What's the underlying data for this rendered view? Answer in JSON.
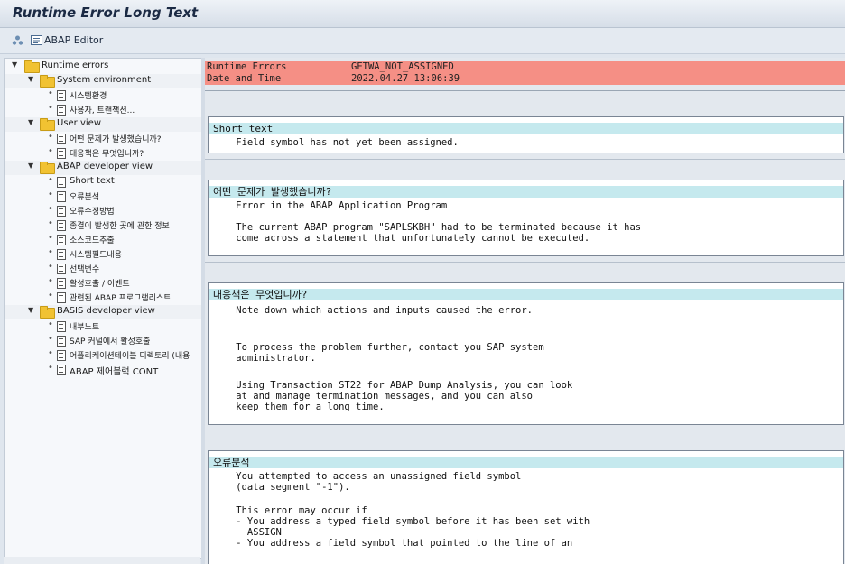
{
  "window": {
    "title": "Runtime Error Long Text"
  },
  "toolbar": {
    "editor_label": "ABAP Editor"
  },
  "tree": {
    "root": "Runtime errors",
    "system_env": {
      "label": "System environment",
      "items": [
        "시스템환경",
        "사용자, 트랜잭션..."
      ]
    },
    "user_view": {
      "label": "User view",
      "items": [
        "어떤 문제가 발생했습니까?",
        "대응책은 무엇입니까?"
      ]
    },
    "abap_dev": {
      "label": "ABAP developer view",
      "items": [
        "Short text",
        "오류분석",
        "오류수정방법",
        "종결이 발생한 곳에 관한 정보",
        "소스코드추출",
        "시스템필드내용",
        "선택변수",
        "활성호출 / 이벤트",
        "관련된 ABAP 프로그램리스트"
      ]
    },
    "basis_dev": {
      "label": "BASIS developer view",
      "items": [
        "내부노트",
        "SAP 커널에서 활성호출",
        "어플리케이션테이블 디렉토리 (내용",
        "ABAP 제어블럭 CONT"
      ]
    }
  },
  "header": {
    "runtime_errors_key": "Runtime Errors",
    "runtime_errors_value": "GETWA_NOT_ASSIGNED",
    "datetime_key": "Date and Time",
    "datetime_value": "2022.04.27 13:06:39"
  },
  "sections": {
    "short_text": {
      "title": "Short text",
      "lines": [
        "    Field symbol has not yet been assigned."
      ]
    },
    "what_happened": {
      "title": "어떤 문제가 발생했습니까?",
      "lines": [
        "    Error in the ABAP Application Program",
        "",
        "    The current ABAP program \"SAPLSKBH\" had to be terminated because it has",
        "    come across a statement that unfortunately cannot be executed."
      ]
    },
    "what_to_do": {
      "title": "대응책은 무엇입니까?",
      "lines": [
        "    Note down which actions and inputs caused the error.",
        "",
        "",
        "    To process the problem further, contact you SAP system",
        "    administrator.",
        "",
        "    Using Transaction ST22 for ABAP Dump Analysis, you can look",
        "    at and manage termination messages, and you can also",
        "    keep them for a long time."
      ]
    },
    "error_analysis": {
      "title": "오류분석",
      "lines": [
        "    You attempted to access an unassigned field symbol",
        "    (data segment \"-1\").",
        "",
        "    This error may occur if",
        "    - You address a typed field symbol before it has been set with",
        "      ASSIGN",
        "    - You address a field symbol that pointed to the line of an"
      ]
    }
  },
  "colors": {
    "header_bg": "#f58f85",
    "section_head_bg": "#c5e9ee",
    "folder": "#f1c232"
  }
}
